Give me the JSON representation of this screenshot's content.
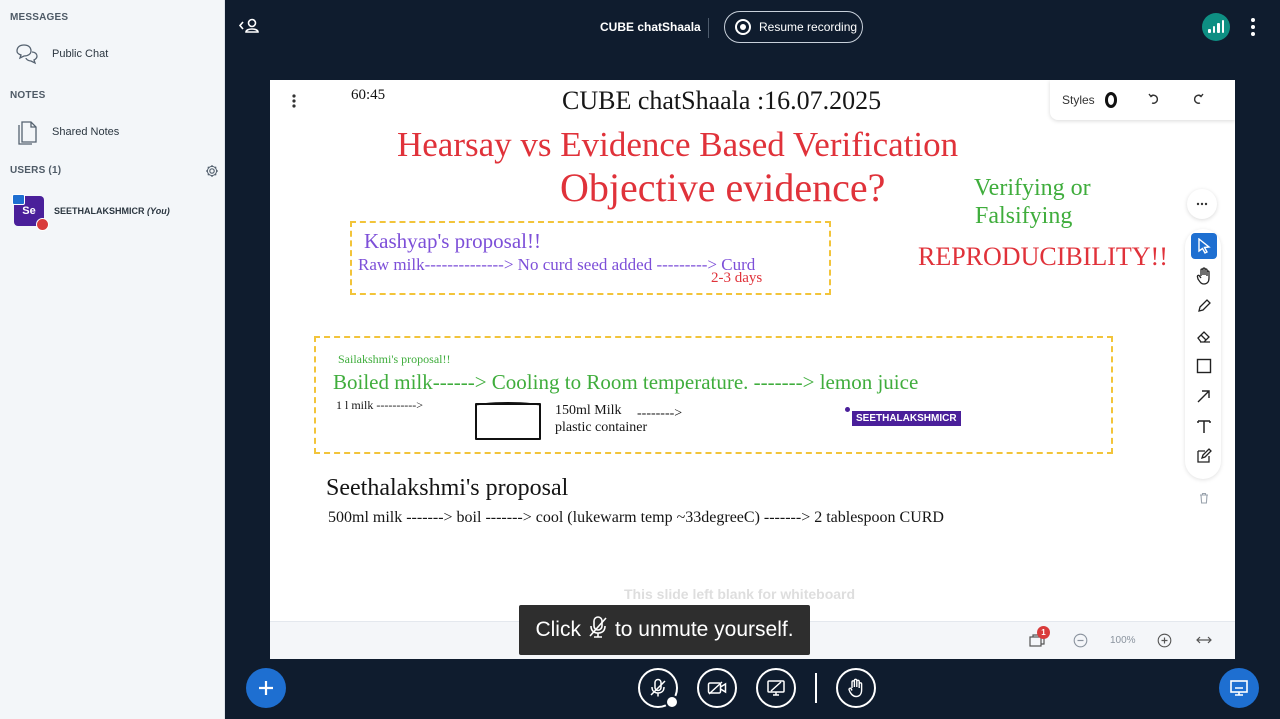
{
  "sidebar": {
    "messages_title": "MESSAGES",
    "public_chat": "Public Chat",
    "notes_title": "NOTES",
    "shared_notes": "Shared Notes",
    "users_title": "USERS (1)",
    "user": {
      "initials": "Se",
      "name": "SEETHALAKSHMICR",
      "you": "(You)"
    }
  },
  "topbar": {
    "title": "CUBE chatShaala",
    "record_label": "Resume recording"
  },
  "slide": {
    "timer": "60:45",
    "title": "CUBE chatShaala :16.07.2025",
    "styles_label": "Styles",
    "heading1": "Hearsay vs  Evidence Based Verification",
    "heading2": "Objective evidence?",
    "verify1": "Verifying or",
    "verify2": "Falsifying",
    "reproducibility": "REPRODUCIBILITY!!",
    "kashyap_title": "Kashyap's proposal!!",
    "kashyap_line": "Raw milk--------------> No curd seed added ---------> Curd",
    "kashyap_days": "2-3 days",
    "sailakshmi_title": "Sailakshmi's proposal!!",
    "sailakshmi_line": "Boiled milk------> Cooling to Room temperature. -------> lemon juice",
    "milk_qty": "1 l milk ---------->",
    "container_line1": "150ml Milk",
    "container_line2": "plastic container",
    "container_arrow": "-------->",
    "cursor_user": "SEETHALAKSHMICR",
    "seetha_title": "Seethalakshmi's proposal",
    "seetha_line": "500ml milk -------> boil -------> cool (lukewarm temp ~33degreeC) -------> 2 tablespoon CURD",
    "blank_note": "This slide left blank for whiteboard"
  },
  "board_bottom": {
    "zoom": "100%",
    "notification_count": "1"
  },
  "toast": {
    "before": "Click",
    "after": "to unmute yourself."
  },
  "colors": {
    "accent": "#1e6fd1",
    "background": "#0f1c2e",
    "red_text": "#e0323a",
    "green_text": "#3fad3c",
    "purple_text": "#7d4fd8",
    "dash_yellow": "#f2c43a",
    "user_purple": "#4a1f9a",
    "connection_teal": "#0e8f83"
  },
  "icons": [
    "chat-icon",
    "notes-icon",
    "gear-icon",
    "users-icon",
    "record-icon",
    "connection-icon",
    "kebab-icon",
    "undo-icon",
    "redo-icon",
    "select-icon",
    "hand-icon",
    "pencil-icon",
    "eraser-icon",
    "rectangle-icon",
    "arrow-icon",
    "text-icon",
    "note-icon",
    "trash-icon",
    "zoom-out-icon",
    "zoom-in-icon",
    "fit-width-icon",
    "mic-off-icon",
    "camera-off-icon",
    "screenshare-off-icon",
    "raise-hand-icon",
    "plus-icon",
    "presentation-icon"
  ]
}
